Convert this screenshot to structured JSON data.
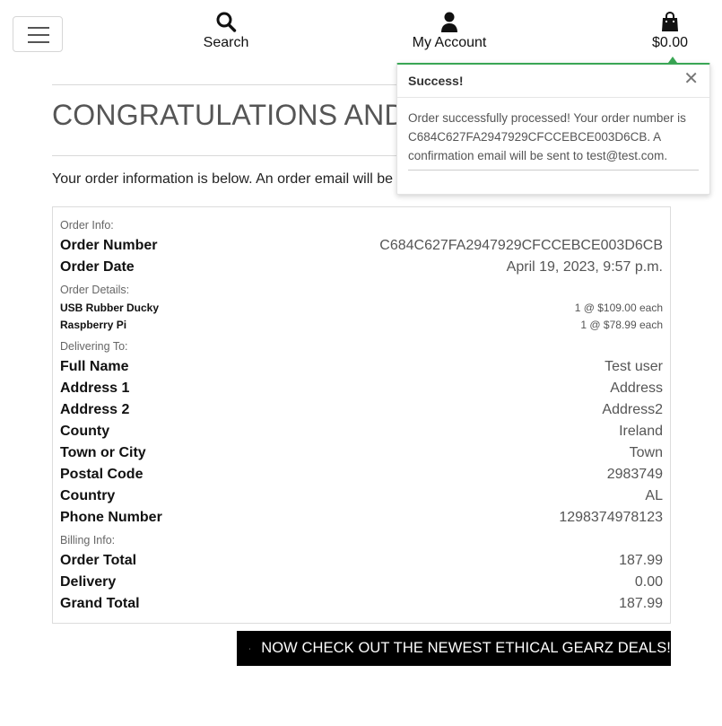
{
  "nav": {
    "menu_icon": "hamburger-icon",
    "search_label": "Search",
    "search_icon": "search-icon",
    "account_label": "My Account",
    "account_icon": "user-icon",
    "bag_total": "$0.00",
    "bag_icon": "shopping-bag-icon"
  },
  "page": {
    "title": "CONGRATULATIONS AND",
    "intro": "Your order information is below. An order email will be s"
  },
  "order": {
    "order_info_label": "Order Info:",
    "order_number_label": "Order Number",
    "order_number": "C684C627FA2947929CFCCEBCE003D6CB",
    "order_date_label": "Order Date",
    "order_date": "April 19, 2023, 9:57 p.m.",
    "order_details_label": "Order Details:",
    "items": [
      {
        "name": "USB Rubber Ducky",
        "qty_price": "1 @ $109.00 each"
      },
      {
        "name": "Raspberry Pi",
        "qty_price": "1 @ $78.99 each"
      }
    ],
    "delivering_label": "Delivering To:",
    "delivery": [
      {
        "label": "Full Name",
        "value": "Test user"
      },
      {
        "label": "Address 1",
        "value": "Address"
      },
      {
        "label": "Address 2",
        "value": "Address2"
      },
      {
        "label": "County",
        "value": "Ireland"
      },
      {
        "label": "Town or City",
        "value": "Town"
      },
      {
        "label": "Postal Code",
        "value": "2983749"
      },
      {
        "label": "Country",
        "value": "AL"
      },
      {
        "label": "Phone Number",
        "value": "1298374978123"
      }
    ],
    "billing_label": "Billing Info:",
    "billing": [
      {
        "label": "Order Total",
        "value": "187.99"
      },
      {
        "label": "Delivery",
        "value": "0.00"
      },
      {
        "label": "Grand Total",
        "value": "187.99"
      }
    ]
  },
  "toast": {
    "title": "Success!",
    "close_icon": "close-icon",
    "message": "Order successfully processed! Your order number is C684C627FA2947929CFCCEBCE003D6CB. A confirmation email will be sent to test@test.com.",
    "accent_color": "#3aa655"
  },
  "cta": {
    "icon": "gift-icon",
    "label": "NOW CHECK OUT THE NEWEST ETHICAL GEARZ DEALS!"
  }
}
